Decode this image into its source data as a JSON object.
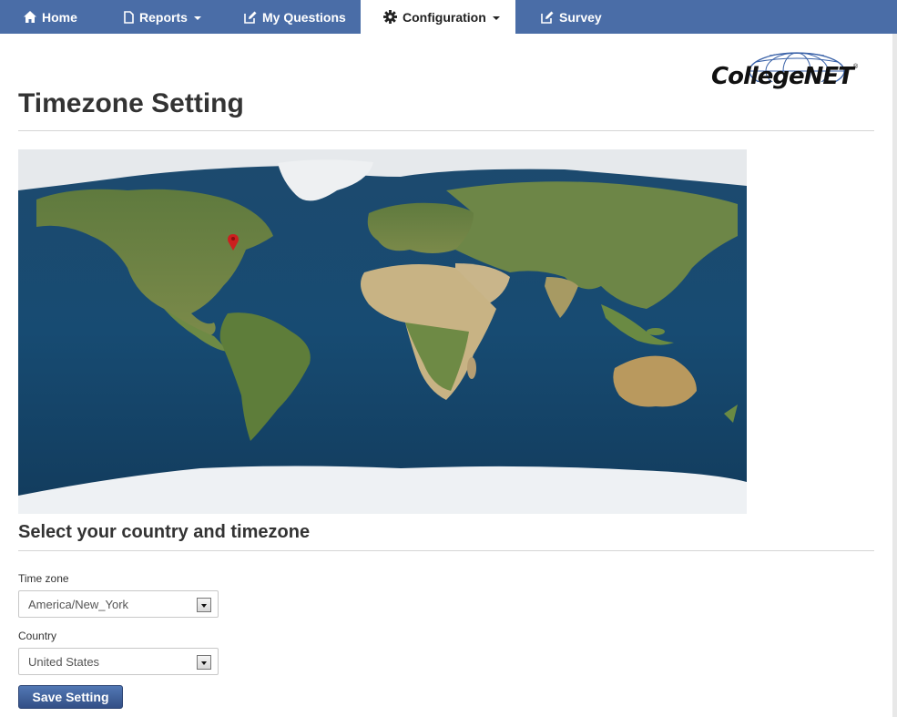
{
  "nav": {
    "items": [
      {
        "label": "Home",
        "icon": "home-icon"
      },
      {
        "label": "Reports",
        "icon": "report-icon",
        "dropdown": true
      },
      {
        "label": "My Questions",
        "icon": "edit-icon"
      },
      {
        "label": "Configuration",
        "icon": "gear-icon",
        "dropdown": true,
        "active": true
      },
      {
        "label": "Survey",
        "icon": "edit-icon"
      }
    ],
    "bar_color": "#4a6da7"
  },
  "logo": {
    "text": "CollegeNET",
    "trademark": "®"
  },
  "page_title": "Timezone Setting",
  "map": {
    "marker_icon": "map-marker-icon",
    "marker_color": "#cc1f1f"
  },
  "section_title": "Select your country and timezone",
  "form": {
    "timezone": {
      "label": "Time zone",
      "value": "America/New_York"
    },
    "country": {
      "label": "Country",
      "value": "United States"
    },
    "save_label": "Save Setting"
  }
}
